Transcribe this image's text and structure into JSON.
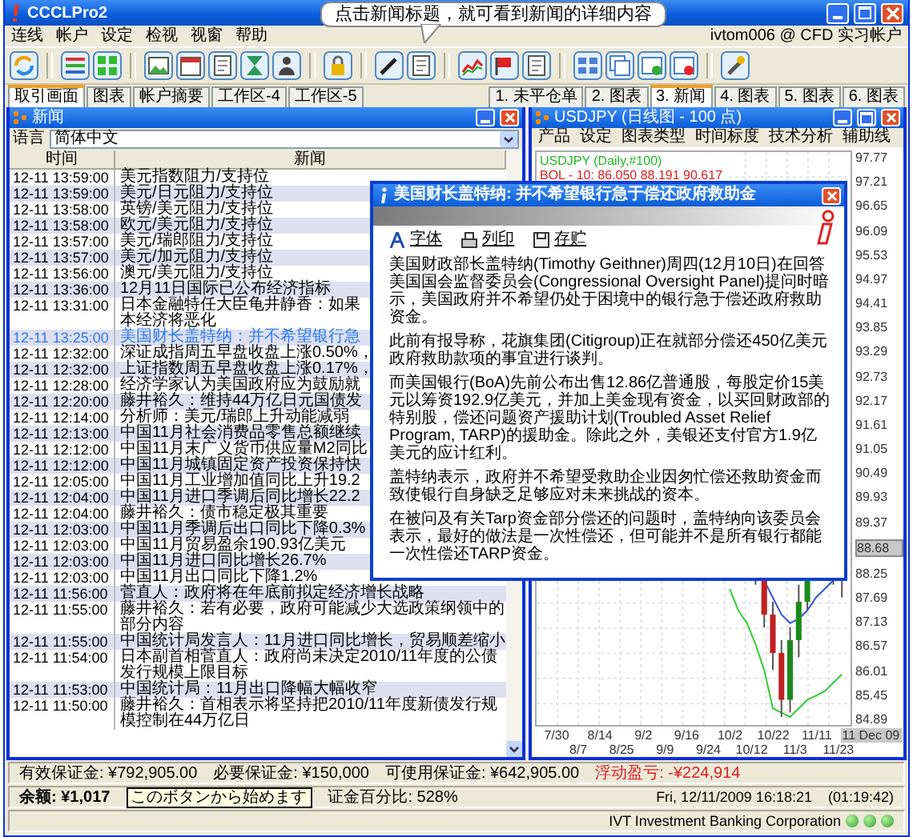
{
  "callout": {
    "text": "点击新闻标题，就可看到新闻的详细内容"
  },
  "window": {
    "title": "CCCLPro2"
  },
  "menu": [
    "连线",
    "帐户",
    "设定",
    "检视",
    "视窗",
    "帮助"
  ],
  "account": "ivtom006 @ CFD 实习帐户",
  "left_tabs": [
    {
      "label": "取引画面",
      "selected": true
    },
    {
      "label": "图表",
      "selected": false
    },
    {
      "label": "帐户摘要",
      "selected": false
    },
    {
      "label": "工作区-4",
      "selected": false
    },
    {
      "label": "工作区-5",
      "selected": false
    }
  ],
  "right_tabs": [
    {
      "label": "1. 未平仓单",
      "selected": false
    },
    {
      "label": "2. 图表",
      "selected": false
    },
    {
      "label": "3. 新闻",
      "selected": true
    },
    {
      "label": "4. 图表",
      "selected": false
    },
    {
      "label": "5. 图表",
      "selected": false
    },
    {
      "label": "6. 图表",
      "selected": false
    }
  ],
  "news_panel": {
    "title": "新闻",
    "language_label": "语言",
    "language": "简体中文",
    "columns": [
      "时间",
      "新闻"
    ],
    "rows": [
      {
        "time": "12-11 13:59:00",
        "headline": "美元指数阻力/支持位",
        "selected": false
      },
      {
        "time": "12-11 13:59:00",
        "headline": "美元/日元阻力/支持位",
        "selected": false
      },
      {
        "time": "12-11 13:58:00",
        "headline": "英镑/美元阻力/支持位",
        "selected": false
      },
      {
        "time": "12-11 13:58:00",
        "headline": "欧元/美元阻力/支持位",
        "selected": false
      },
      {
        "time": "12-11 13:57:00",
        "headline": "美元/瑞郎阻力/支持位",
        "selected": false
      },
      {
        "time": "12-11 13:57:00",
        "headline": "美元/加元阻力/支持位",
        "selected": false
      },
      {
        "time": "12-11 13:56:00",
        "headline": "澳元/美元阻力/支持位",
        "selected": false
      },
      {
        "time": "12-11 13:36:00",
        "headline": "12月11日国际已公布经济指标",
        "selected": false
      },
      {
        "time": "12-11 13:31:00",
        "headline": "日本金融特任大臣龟井静香：如果",
        "second_line": "本经济将恶化",
        "selected": false
      },
      {
        "time": "12-11 13:25:00",
        "headline": "美国财长盖特纳：并不希望银行急",
        "selected": true
      },
      {
        "time": "12-11 12:32:00",
        "headline": "深证成指周五早盘收盘上涨0.50%，",
        "selected": false
      },
      {
        "time": "12-11 12:32:00",
        "headline": "上证指数周五早盘收盘上涨0.17%，",
        "selected": false
      },
      {
        "time": "12-11 12:28:00",
        "headline": "经济学家认为美国政府应为鼓励就",
        "selected": false
      },
      {
        "time": "12-11 12:20:00",
        "headline": "藤井裕久：维持44万亿日元国债发",
        "selected": false
      },
      {
        "time": "12-11 12:14:00",
        "headline": "分析师：美元/瑞郎上升动能减弱",
        "selected": false
      },
      {
        "time": "12-11 12:13:00",
        "headline": "中国11月社会消费品零售总额继续",
        "selected": false
      },
      {
        "time": "12-11 12:12:00",
        "headline": "中国11月末广义货币供应量M2同比",
        "selected": false
      },
      {
        "time": "12-11 12:12:00",
        "headline": "中国11月城镇固定资产投资保持快",
        "selected": false
      },
      {
        "time": "12-11 12:05:00",
        "headline": "中国11月工业增加值同比上升19.2",
        "selected": false
      },
      {
        "time": "12-11 12:04:00",
        "headline": "中国11月进口季调后同比增长22.2",
        "selected": false
      },
      {
        "time": "12-11 12:04:00",
        "headline": "藤井裕久：债市稳定极其重要",
        "selected": false
      },
      {
        "time": "12-11 12:03:00",
        "headline": "中国11月季调后出口同比下降0.3%",
        "selected": false
      },
      {
        "time": "12-11 12:03:00",
        "headline": "中国11月贸易盈余190.93亿美元",
        "selected": false
      },
      {
        "time": "12-11 12:03:00",
        "headline": "中国11月进口同比增长26.7%",
        "selected": false
      },
      {
        "time": "12-11 12:03:00",
        "headline": "中国11月出口同比下降1.2%",
        "selected": false
      },
      {
        "time": "12-11 11:56:00",
        "headline": "菅直人：政府将在年底前拟定经济增长战略",
        "selected": false
      },
      {
        "time": "12-11 11:55:00",
        "headline": "藤井裕久：若有必要，政府可能减少大选政策纲领中的部分内容",
        "selected": false
      },
      {
        "time": "12-11 11:55:00",
        "headline": "中国统计局发言人：11月进口同比增长，贸易顺差缩小",
        "selected": false
      },
      {
        "time": "12-11 11:54:00",
        "headline": "日本副首相菅直人：政府尚未决定2010/11年度的公债发行规模上限目标",
        "selected": false
      },
      {
        "time": "12-11 11:53:00",
        "headline": "中国统计局：11月出口降幅大幅收窄",
        "selected": false
      },
      {
        "time": "12-11 11:50:00",
        "headline": "藤井裕久：首相表示将坚持把2010/11年度新债发行规模控制在44万亿日",
        "selected": false
      }
    ]
  },
  "chart_panel": {
    "title": "USDJPY (日线图 - 100 点)",
    "menu": [
      "产品",
      "设定",
      "图表类型",
      "时间标度",
      "技术分析",
      "辅助线"
    ],
    "legend": [
      {
        "text": "USDJPY (Daily,#100)",
        "color": "#22b822"
      },
      {
        "text": "BOL - 10: 86.050 88.191 90.617",
        "color": "#e02020"
      }
    ],
    "y_labels": [
      {
        "text": "97.77",
        "current": false
      },
      {
        "text": "97.21",
        "current": false
      },
      {
        "text": "96.65",
        "current": false
      },
      {
        "text": "96.09",
        "current": false
      },
      {
        "text": "95.53",
        "current": false
      },
      {
        "text": "94.97",
        "current": false
      },
      {
        "text": "94.41",
        "current": false
      },
      {
        "text": "93.85",
        "current": false
      },
      {
        "text": "93.29",
        "current": false
      },
      {
        "text": "92.73",
        "current": false
      },
      {
        "text": "92.17",
        "current": false
      },
      {
        "text": "91.61",
        "current": false
      },
      {
        "text": "91.05",
        "current": false
      },
      {
        "text": "90.49",
        "current": false
      },
      {
        "text": "89.93",
        "current": false
      },
      {
        "text": "89.37",
        "current": false
      },
      {
        "text": "88.68",
        "current": true
      },
      {
        "text": "88.25",
        "current": false
      },
      {
        "text": "87.69",
        "current": false
      },
      {
        "text": "87.13",
        "current": false
      },
      {
        "text": "86.57",
        "current": false
      },
      {
        "text": "86.01",
        "current": false
      },
      {
        "text": "85.45",
        "current": false
      },
      {
        "text": "84.89",
        "current": false
      }
    ],
    "x_labels": [
      {
        "text": "7/30",
        "current": false
      },
      {
        "text": "8/7",
        "current": false
      },
      {
        "text": "8/14",
        "current": false
      },
      {
        "text": "8/25",
        "current": false
      },
      {
        "text": "9/2",
        "current": false
      },
      {
        "text": "9/9",
        "current": false
      },
      {
        "text": "9/16",
        "current": false
      },
      {
        "text": "9/24",
        "current": false
      },
      {
        "text": "10/2",
        "current": false
      },
      {
        "text": "10/12",
        "current": false
      },
      {
        "text": "10/22",
        "current": false
      },
      {
        "text": "11/3",
        "current": false
      },
      {
        "text": "11/11",
        "current": false
      },
      {
        "text": "11/23",
        "current": false
      },
      {
        "text": "11 Dec 09",
        "current": true
      }
    ]
  },
  "news_popup": {
    "title": "美国财长盖特纳: 并不希望银行急于偿还政府救助金",
    "actions": [
      {
        "label": "字体",
        "kind": "font"
      },
      {
        "label": "列印",
        "kind": "print"
      },
      {
        "label": "存贮",
        "kind": "save"
      }
    ],
    "paragraphs": [
      "美国财政部长盖特纳(Timothy Geithner)周四(12月10日)在回答美国国会监督委员会(Congressional Oversight Panel)提问时暗示，美国政府并不希望仍处于困境中的银行急于偿还政府救助资金。",
      "此前有报导称，花旗集团(Citigroup)正在就部分偿还450亿美元政府救助款项的事宜进行谈判。",
      "而美国银行(BoA)先前公布出售12.86亿普通股，每股定价15美元以筹资192.9亿美元，并加上美金现有资金，以买回财政部的特别股，偿还问题资产援助计划(Troubled Asset Relief Program, TARP)的援助金。除此之外，美银还支付官方1.9亿美元的应计红利。",
      "盖特纳表示，政府并不希望受救助企业因匆忙偿还救助资金而致使银行自身缺乏足够应对未来挑战的资本。",
      "在被问及有关Tarp资金部分偿还的问题时，盖特纳向该委员会表示，最好的做法是一次性偿还，但可能并不是所有银行都能一次性偿还TARP资金。"
    ]
  },
  "status_bar": {
    "figures": [
      {
        "text": "有效保证金: ¥792,905.00",
        "alert": false
      },
      {
        "text": "必要保证金: ¥150,000",
        "alert": false
      },
      {
        "text": "可使用保证金: ¥642,905.00",
        "alert": false
      },
      {
        "text": "浮动盈亏: -¥224,914",
        "alert": true
      }
    ],
    "balance": "余额: ¥1,017",
    "tooltip": "このボタンから始めます",
    "margin_ratio": "证金百分比: 528%",
    "datetime": "Fri, 12/11/2009 16:18:21",
    "elapsed": "(01:19:42)",
    "company": "IVT Investment Banking Corporation"
  }
}
